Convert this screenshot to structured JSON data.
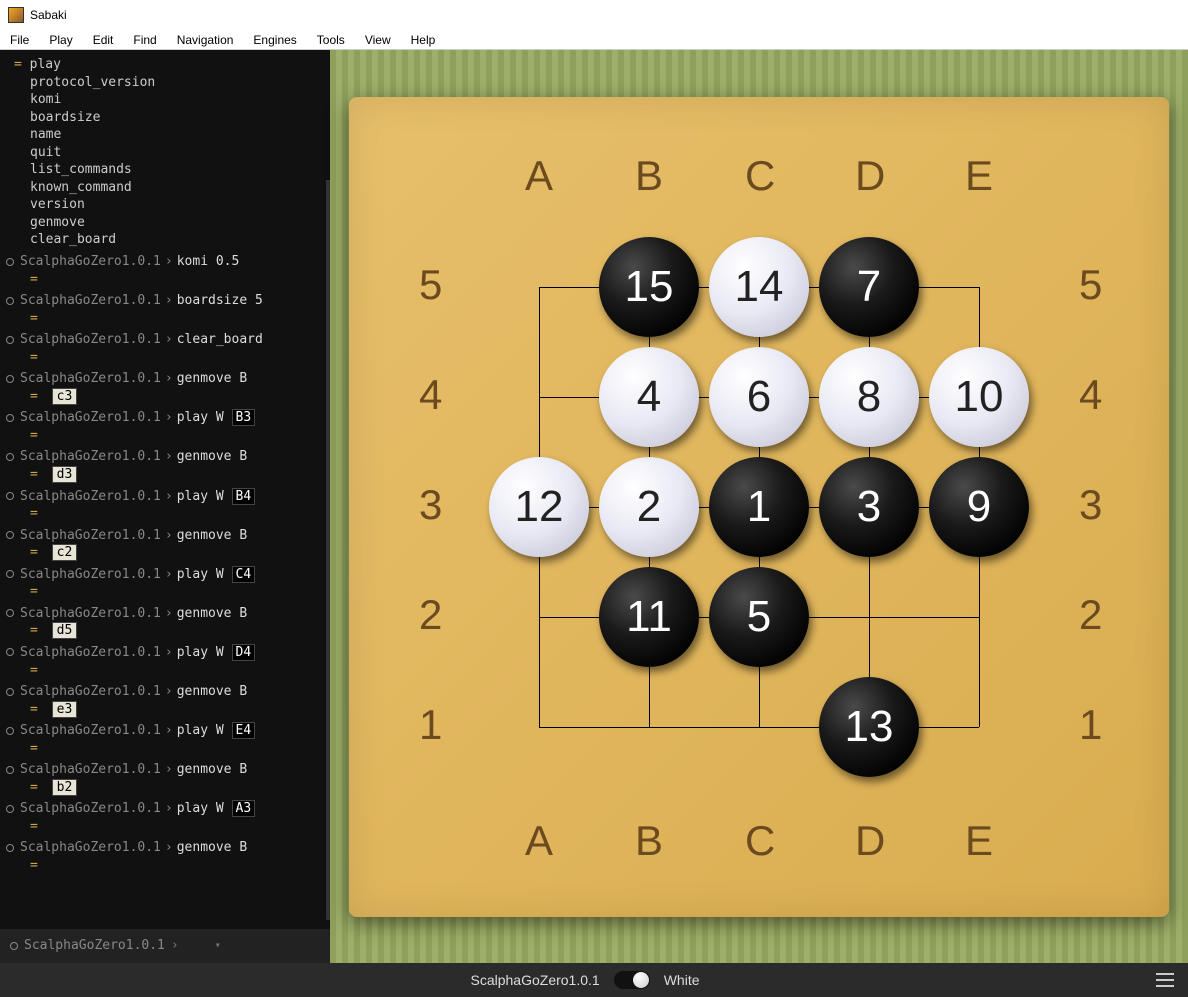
{
  "window": {
    "title": "Sabaki"
  },
  "menu": [
    "File",
    "Play",
    "Edit",
    "Find",
    "Navigation",
    "Engines",
    "Tools",
    "View",
    "Help"
  ],
  "console": {
    "preamble": [
      "play",
      "protocol_version",
      "komi",
      "boardsize",
      "name",
      "quit",
      "list_commands",
      "known_command",
      "version",
      "genmove",
      "clear_board"
    ],
    "engine": "ScalphaGoZero1.0.1",
    "entries": [
      {
        "cmd": "komi 0.5",
        "res": ""
      },
      {
        "cmd": "boardsize 5",
        "res": ""
      },
      {
        "cmd": "clear_board",
        "res": ""
      },
      {
        "cmd": "genmove B",
        "res": "c3"
      },
      {
        "cmd": "play W",
        "argbox": "B3",
        "res": ""
      },
      {
        "cmd": "genmove B",
        "res": "d3"
      },
      {
        "cmd": "play W",
        "argbox": "B4",
        "res": ""
      },
      {
        "cmd": "genmove B",
        "res": "c2"
      },
      {
        "cmd": "play W",
        "argbox": "C4",
        "res": ""
      },
      {
        "cmd": "genmove B",
        "res": "d5"
      },
      {
        "cmd": "play W",
        "argbox": "D4",
        "res": ""
      },
      {
        "cmd": "genmove B",
        "res": "e3"
      },
      {
        "cmd": "play W",
        "argbox": "E4",
        "res": ""
      },
      {
        "cmd": "genmove B",
        "res": "b2"
      },
      {
        "cmd": "play W",
        "argbox": "A3",
        "res": ""
      },
      {
        "cmd": "genmove B",
        "res": ""
      }
    ],
    "prompt_engine": "ScalphaGoZero1.0.1"
  },
  "board": {
    "cols": [
      "A",
      "B",
      "C",
      "D",
      "E"
    ],
    "rows": [
      "5",
      "4",
      "3",
      "2",
      "1"
    ],
    "stones": [
      {
        "n": 1,
        "color": "black",
        "col": 2,
        "row": 2
      },
      {
        "n": 2,
        "color": "white",
        "col": 1,
        "row": 2
      },
      {
        "n": 3,
        "color": "black",
        "col": 3,
        "row": 2
      },
      {
        "n": 4,
        "color": "white",
        "col": 1,
        "row": 1
      },
      {
        "n": 5,
        "color": "black",
        "col": 2,
        "row": 3
      },
      {
        "n": 6,
        "color": "white",
        "col": 2,
        "row": 1
      },
      {
        "n": 7,
        "color": "black",
        "col": 3,
        "row": 0
      },
      {
        "n": 8,
        "color": "white",
        "col": 3,
        "row": 1
      },
      {
        "n": 9,
        "color": "black",
        "col": 4,
        "row": 2
      },
      {
        "n": 10,
        "color": "white",
        "col": 4,
        "row": 1
      },
      {
        "n": 11,
        "color": "black",
        "col": 1,
        "row": 3
      },
      {
        "n": 12,
        "color": "white",
        "col": 0,
        "row": 2
      },
      {
        "n": 13,
        "color": "black",
        "col": 3,
        "row": 4
      },
      {
        "n": 14,
        "color": "white",
        "col": 2,
        "row": 0
      },
      {
        "n": 15,
        "color": "black",
        "col": 1,
        "row": 0
      }
    ]
  },
  "status": {
    "engine": "ScalphaGoZero1.0.1",
    "side": "White"
  }
}
